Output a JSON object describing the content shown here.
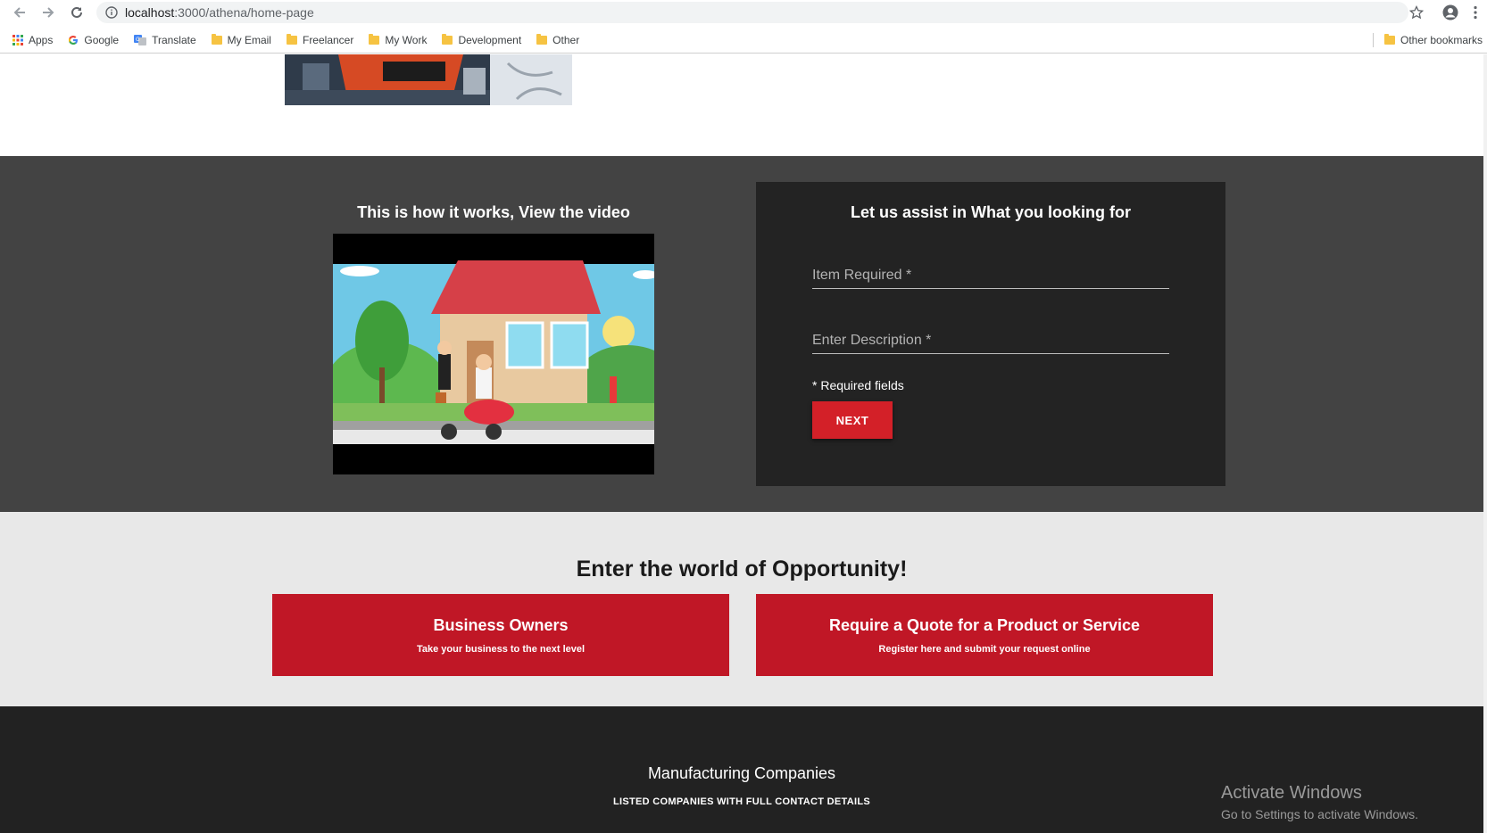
{
  "browser": {
    "url_host": "localhost",
    "url_path": ":3000/athena/home-page",
    "bookmarks": [
      {
        "label": "Apps",
        "icon": "apps-grid-icon"
      },
      {
        "label": "Google",
        "icon": "google-icon"
      },
      {
        "label": "Translate",
        "icon": "translate-icon"
      },
      {
        "label": "My Email",
        "icon": "folder-icon"
      },
      {
        "label": "Freelancer",
        "icon": "folder-icon"
      },
      {
        "label": "My Work",
        "icon": "folder-icon"
      },
      {
        "label": "Development",
        "icon": "folder-icon"
      },
      {
        "label": "Other",
        "icon": "folder-icon"
      }
    ],
    "other_bookmarks": "Other bookmarks"
  },
  "video_section": {
    "title": "This is how it works, View the video"
  },
  "assist_form": {
    "title": "Let us assist in What you looking for",
    "item_placeholder": "Item Required *",
    "description_placeholder": "Enter Description *",
    "required_note": "* Required fields",
    "next_label": "NEXT"
  },
  "opportunity": {
    "title": "Enter the world of Opportunity!",
    "cards": [
      {
        "heading": "Business Owners",
        "subtitle": "Take your business to the next level"
      },
      {
        "heading": "Require a Quote for a Product or Service",
        "subtitle": "Register here and submit your request online"
      }
    ]
  },
  "footer": {
    "title": "Manufacturing Companies",
    "subtitle": "LISTED COMPANIES WITH FULL CONTACT DETAILS"
  },
  "watermark": {
    "line1": "Activate Windows",
    "line2": "Go to Settings to activate Windows."
  },
  "colors": {
    "accent_red": "#c01726",
    "button_red": "#d32028",
    "dark_band": "#434343",
    "card_dark": "#232323",
    "footer_dark": "#222222"
  }
}
